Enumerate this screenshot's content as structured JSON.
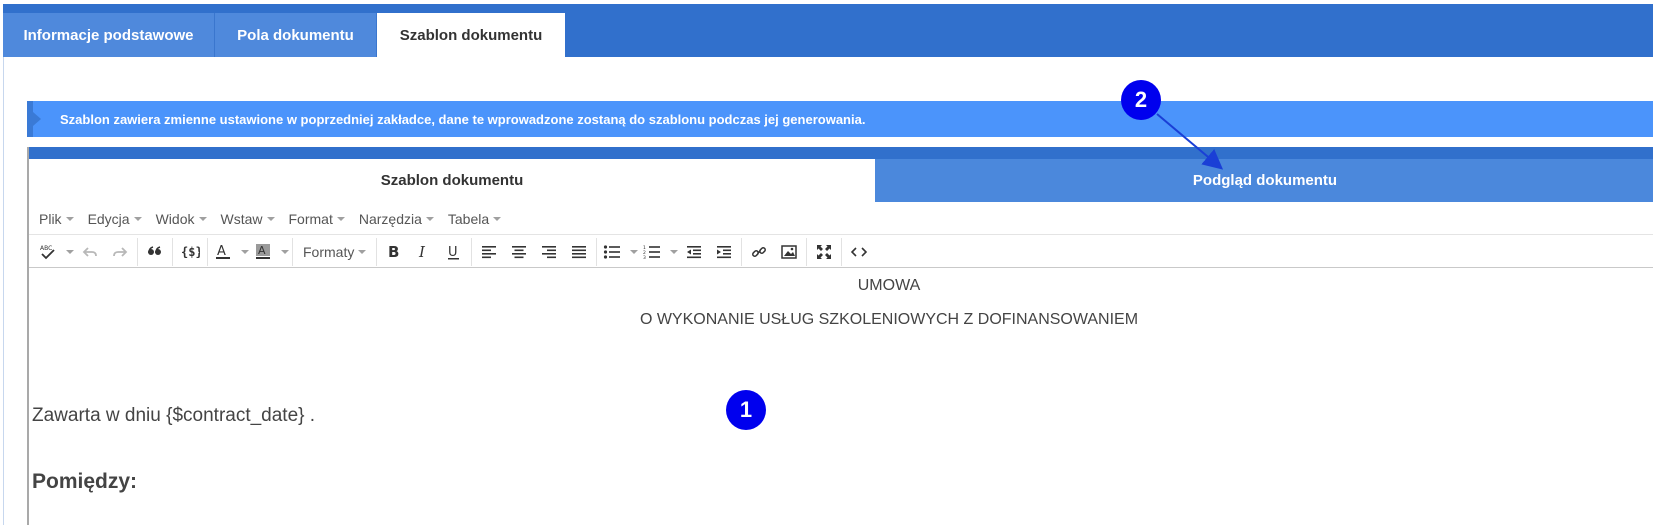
{
  "top_tabs": [
    {
      "label": "Informacje podstawowe"
    },
    {
      "label": "Pola dokumentu"
    },
    {
      "label": "Szablon dokumentu"
    }
  ],
  "banner": {
    "text": "Szablon zawiera zmienne ustawione w poprzedniej zakładce, dane te wprowadzone zostaną do szablonu podczas jej generowania."
  },
  "editor_tabs": [
    {
      "label": "Szablon dokumentu"
    },
    {
      "label": "Podgląd dokumentu"
    }
  ],
  "menubar": [
    {
      "label": "Plik"
    },
    {
      "label": "Edycja"
    },
    {
      "label": "Widok"
    },
    {
      "label": "Wstaw"
    },
    {
      "label": "Format"
    },
    {
      "label": "Narzędzia"
    },
    {
      "label": "Tabela"
    }
  ],
  "toolbar": {
    "formats_label": "Formaty"
  },
  "document": {
    "title_line1": "UMOWA",
    "title_line2": "O WYKONANIE USŁUG SZKOLENIOWYCH Z DOFINANSOWANIEM",
    "date_line": "Zawarta w dniu {$contract_date} .",
    "between_line": "Pomiędzy:"
  },
  "markers": {
    "one": "1",
    "two": "2"
  },
  "colors": {
    "header_blue": "#3170cc",
    "banner_blue": "#4b94fb",
    "marker_blue": "#0000ee"
  }
}
